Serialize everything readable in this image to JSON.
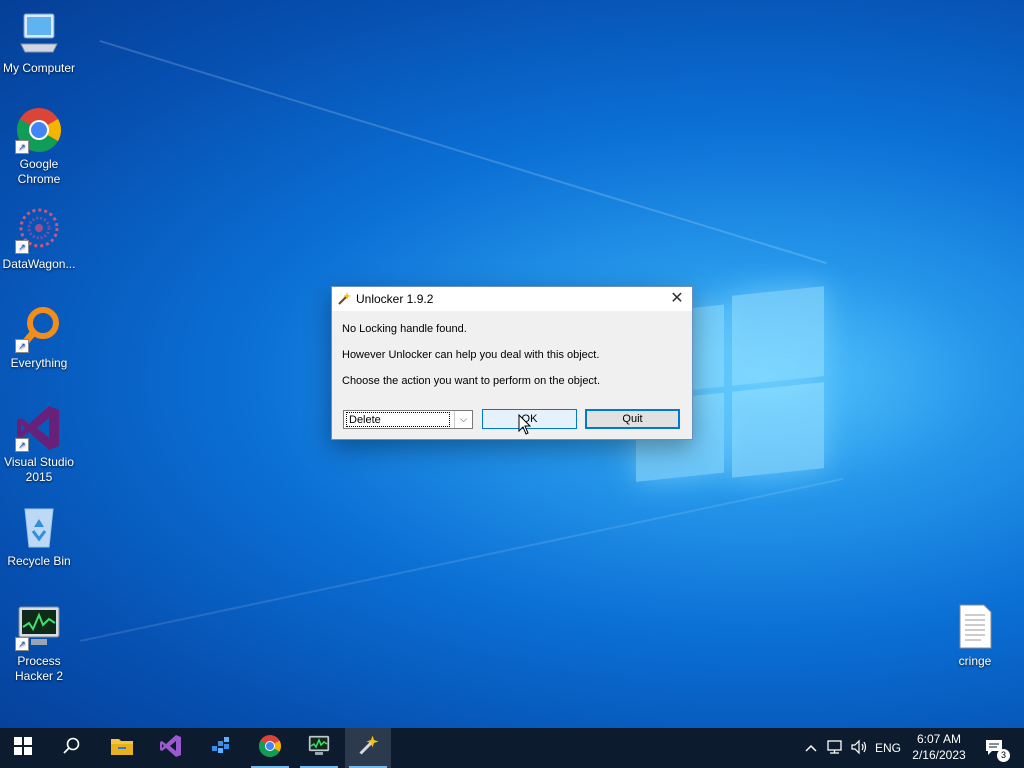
{
  "desktop": {
    "icons": [
      {
        "label": "My Computer",
        "icon": "computer-icon"
      },
      {
        "label": "Google Chrome",
        "icon": "chrome-icon",
        "shortcut": true
      },
      {
        "label": "DataWagon...",
        "icon": "datawagon-icon",
        "shortcut": true
      },
      {
        "label": "Everything",
        "icon": "everything-search-icon",
        "shortcut": true
      },
      {
        "label": "Visual Studio 2015",
        "icon": "visual-studio-icon",
        "shortcut": true
      },
      {
        "label": "Recycle Bin",
        "icon": "recycle-bin-icon"
      },
      {
        "label": "Process Hacker 2",
        "icon": "process-hacker-icon",
        "shortcut": true
      },
      {
        "label": "cringe",
        "icon": "text-file-icon"
      }
    ]
  },
  "dialog": {
    "title": "Unlocker 1.9.2",
    "close_symbol": "✕",
    "messages": [
      "No Locking handle found.",
      "However Unlocker can help you deal with this object.",
      "Choose the action you want to perform on the object."
    ],
    "action_select": {
      "selected": "Delete"
    },
    "ok_label": "OK",
    "quit_label": "Quit"
  },
  "taskbar": {
    "pinned": [
      "start-icon",
      "search-icon",
      "file-explorer-icon",
      "visual-studio-icon",
      "datawagon-icon",
      "chrome-icon",
      "process-hacker-icon",
      "unlocker-icon"
    ],
    "tray": {
      "language": "ENG",
      "time": "6:07 AM",
      "date": "2/16/2023",
      "notification_count": "3"
    }
  },
  "colors": {
    "accent": "#0078d7",
    "taskbar_bg": "#0c1c2e",
    "desktop_bg": "#0b6fd4"
  }
}
